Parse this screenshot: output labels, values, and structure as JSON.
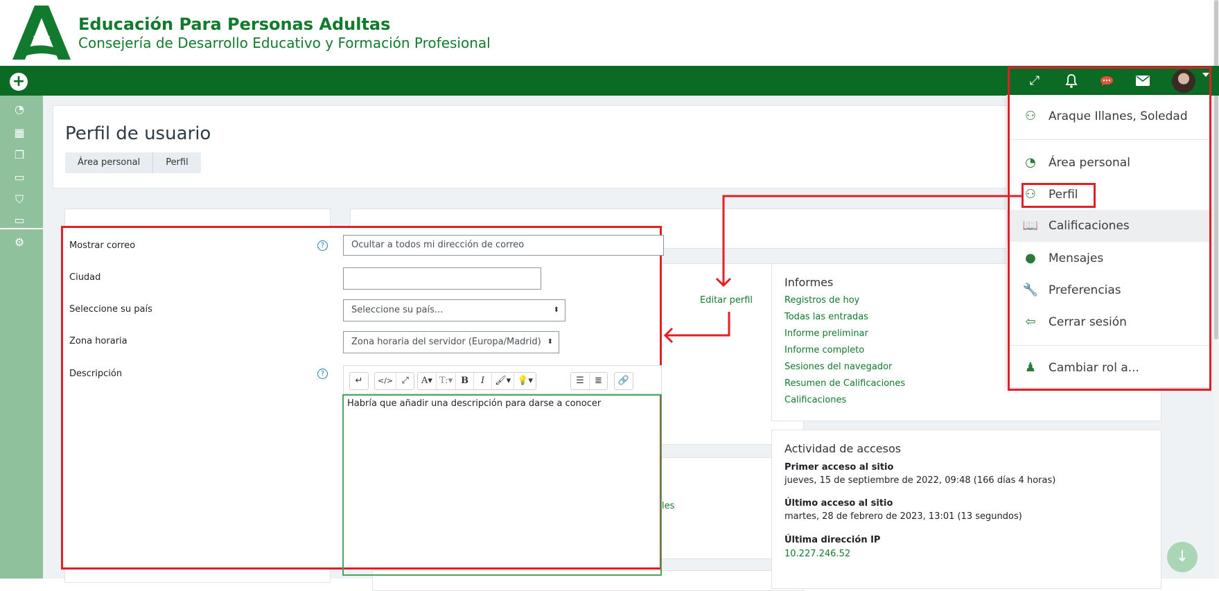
{
  "brand": {
    "title": "Educación Para Personas Adultas",
    "subtitle": "Consejería de Desarrollo Educativo y Formación Profesional"
  },
  "navbar": {
    "add_icon": "+",
    "icons": [
      "expand-icon",
      "bell-icon",
      "chat-icon",
      "envelope-icon"
    ]
  },
  "sidebar": {
    "icons": [
      "dashboard-icon",
      "calendar-icon",
      "files-icon",
      "folder-icon",
      "graduation-cap-icon",
      "folder-icon",
      "gear-icon"
    ]
  },
  "page": {
    "title": "Perfil de usuario",
    "breadcrumb": [
      "Área personal",
      "Perfil"
    ]
  },
  "form": {
    "email": {
      "label": "Mostrar correo",
      "value": "Ocultar a todos mi dirección de correo"
    },
    "city": {
      "label": "Ciudad",
      "value": ""
    },
    "country": {
      "label": "Seleccione su país",
      "value": "Seleccione su país..."
    },
    "timezone": {
      "label": "Zona horaria",
      "value": "Zona horaria del servidor (Europa/Madrid)"
    },
    "description": {
      "label": "Descripción",
      "value": "Habría que añadir una descripción para darse a conocer"
    },
    "help_glyph": "?"
  },
  "editor_toolbar": {
    "buttons": [
      "↵",
      "</>",
      "⤢",
      "A▾",
      "T:▾",
      "B",
      "I",
      "🖌▾",
      "💡▾",
      "☰",
      "≣",
      "🔗"
    ]
  },
  "profile": {
    "edit_link": "Editar perfil",
    "partial_link": "les"
  },
  "reports": {
    "heading": "Informes",
    "links": [
      "Registros de hoy",
      "Todas las entradas",
      "Informe preliminar",
      "Informe completo",
      "Sesiones del navegador",
      "Resumen de Calificaciones",
      "Calificaciones"
    ]
  },
  "access": {
    "heading": "Actividad de accesos",
    "first_label": "Primer acceso al sitio",
    "first_value": "jueves, 15 de septiembre de 2022, 09:48  (166 días 4 horas)",
    "last_label": "Último acceso al sitio",
    "last_value": "martes, 28 de febrero de 2023, 13:01  (13 segundos)",
    "ip_label": "Última dirección IP",
    "ip_value": "10.227.246.52"
  },
  "user_menu": {
    "name": "Araque Illanes, Soledad",
    "items": [
      {
        "label": "Área personal",
        "icon": "dashboard-icon"
      },
      {
        "label": "Perfil",
        "icon": "user-icon"
      },
      {
        "label": "Calificaciones",
        "icon": "book-icon"
      },
      {
        "label": "Mensajes",
        "icon": "chat-icon"
      },
      {
        "label": "Preferencias",
        "icon": "wrench-icon"
      },
      {
        "label": "Cerrar sesión",
        "icon": "logout-icon"
      }
    ],
    "switch_role": "Cambiar rol a..."
  },
  "colors": {
    "brand_green": "#117a2c",
    "navbar_green": "#0b6a23",
    "sidebar_green": "#8fc29c",
    "annotation_red": "#e31e24"
  }
}
